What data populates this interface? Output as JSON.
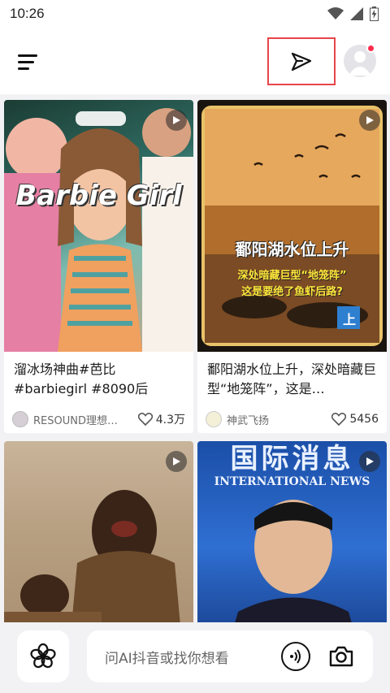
{
  "status_bar": {
    "time": "10:26"
  },
  "colors": {
    "accent_red": "#e8454a",
    "notification_dot": "#ff2a4a"
  },
  "top_bar": {
    "menu_icon": "hamburger-menu-icon",
    "send_icon": "paper-plane-icon",
    "avatar_icon": "user-avatar-icon"
  },
  "feed": {
    "cards": [
      {
        "overlay": "Barbie Girl",
        "title": "溜冰场神曲#芭比 #barbiegirl #8090后",
        "author": "RESOUND理想…",
        "likes": "4.3万"
      },
      {
        "overlay_main": "鄱阳湖水位上升",
        "overlay_sub_1": "深处暗藏巨型“地笼阵”",
        "overlay_sub_2": "这是要绝了鱼虾后路?",
        "overlay_corner": "上",
        "title": "鄱阳湖水位上升，深处暗藏巨型“地笼阵”，这是…",
        "author": "神武飞扬",
        "likes": "5456"
      },
      {
        "title": ""
      },
      {
        "overlay_top": "国际消息",
        "overlay_top_en": "INTERNATIONAL NEWS",
        "title": ""
      }
    ]
  },
  "bottom_bar": {
    "ask_placeholder": "问AI抖音或找你想看",
    "flower_icon": "flower-icon",
    "voice_icon": "voice-search-icon",
    "camera_icon": "camera-icon"
  }
}
